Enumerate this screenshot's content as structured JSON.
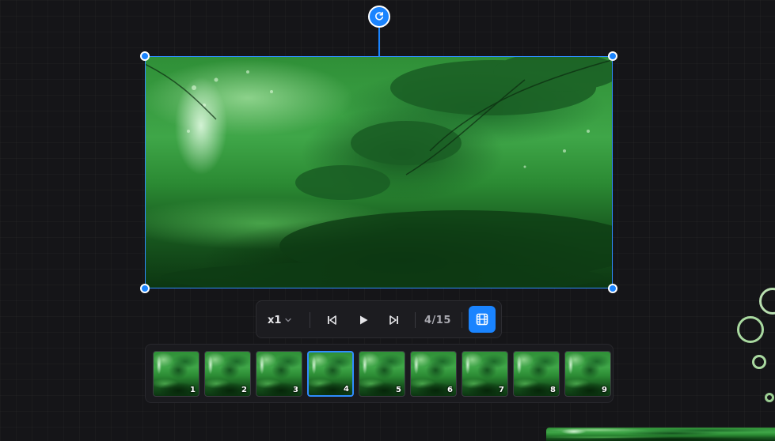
{
  "player": {
    "speed_label": "x1",
    "frame_counter": "4/15",
    "current_frame": 4,
    "total_frames": 15
  },
  "frames": [
    {
      "number": "1",
      "active": false
    },
    {
      "number": "2",
      "active": false
    },
    {
      "number": "3",
      "active": false
    },
    {
      "number": "4",
      "active": true
    },
    {
      "number": "5",
      "active": false
    },
    {
      "number": "6",
      "active": false
    },
    {
      "number": "7",
      "active": false
    },
    {
      "number": "8",
      "active": false
    },
    {
      "number": "9",
      "active": false
    }
  ],
  "icons": {
    "rotate": "rotate-icon",
    "speed_dropdown": "chevron-down-icon",
    "prev": "skip-previous-icon",
    "play": "play-icon",
    "next": "skip-next-icon",
    "filmstrip": "film-icon"
  },
  "colors": {
    "accent": "#1a84ff",
    "background": "#151518",
    "toolbar": "#1c1c20",
    "ring": "#a9d9a0"
  }
}
